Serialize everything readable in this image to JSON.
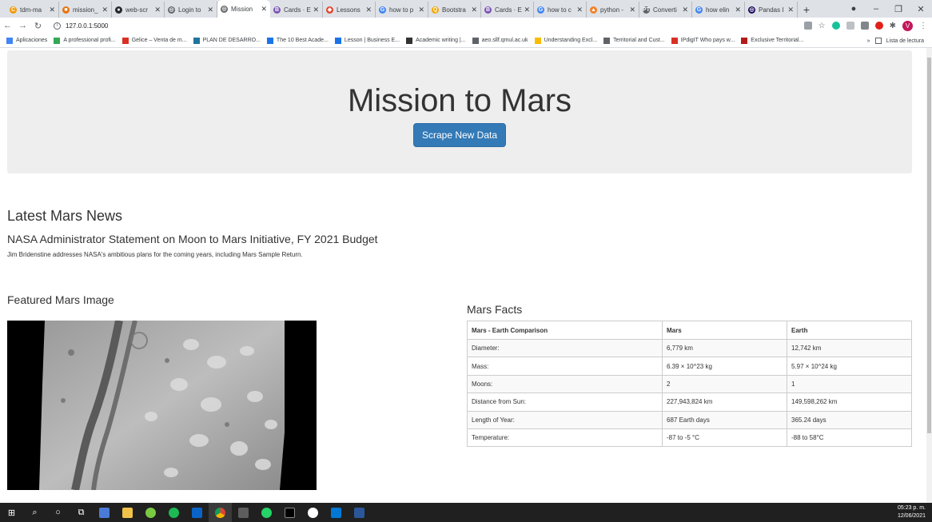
{
  "browser": {
    "tabs": [
      {
        "label": "tdm-ma",
        "color": "#f29900"
      },
      {
        "label": "mission_",
        "color": "#e8710a"
      },
      {
        "label": "web-scr",
        "color": "#24292e"
      },
      {
        "label": "Login to",
        "color": "#5f6368"
      },
      {
        "label": "Mission",
        "color": "#5f6368"
      },
      {
        "label": "Cards · E",
        "color": "#7952b3"
      },
      {
        "label": "Lessons",
        "color": "#e24329"
      },
      {
        "label": "how to p",
        "color": "#4285f4"
      },
      {
        "label": "Bootstra",
        "color": "#f2a600"
      },
      {
        "label": "Cards · E",
        "color": "#7952b3"
      },
      {
        "label": "how to c",
        "color": "#4285f4"
      },
      {
        "label": "python -",
        "color": "#f48024"
      },
      {
        "label": "Converti",
        "color": "#5f6368"
      },
      {
        "label": "how elin",
        "color": "#4285f4"
      },
      {
        "label": "Pandas I",
        "color": "#150458"
      }
    ],
    "tab_glyphs": [
      "C",
      "■",
      "●",
      "◎",
      "◎",
      "B",
      "◆",
      "G",
      "Q",
      "B",
      "G",
      "▲",
      "PT",
      "G",
      "◎"
    ],
    "url": "127.0.0.1:5000",
    "bookmarks": [
      {
        "label": "Aplicaciones",
        "color": "#4285f4"
      },
      {
        "label": "A professional profi...",
        "color": "#34a853"
      },
      {
        "label": "Gelice – Venta de m...",
        "color": "#d93025"
      },
      {
        "label": "PLAN DE DESARRO...",
        "color": "#21759b"
      },
      {
        "label": "The 10 Best Acade...",
        "color": "#1a73e8"
      },
      {
        "label": "Lesson | Business E...",
        "color": "#1a73e8"
      },
      {
        "label": "Academic writing |...",
        "color": "#333333"
      },
      {
        "label": "aeo.sllf.qmul.ac.uk",
        "color": "#5f6368"
      },
      {
        "label": "Understanding Excl...",
        "color": "#fbbc04"
      },
      {
        "label": "Territorial and Cust...",
        "color": "#5f6368"
      },
      {
        "label": "IPdigIT Who pays w...",
        "color": "#d93025"
      },
      {
        "label": "Exclusive Territorial...",
        "color": "#b31b1b"
      }
    ],
    "more_bookmarks": "»",
    "reading_list": "Lista de lectura",
    "profile_initial": "V"
  },
  "page": {
    "title": "Mission to Mars",
    "scrape_button": "Scrape New Data",
    "news_heading": "Latest Mars News",
    "news_title": "NASA Administrator Statement on Moon to Mars Initiative, FY 2021 Budget",
    "news_paragraph": "Jim Bridenstine addresses NASA's ambitious plans for the coming years, including Mars Sample Return.",
    "image_heading": "Featured Mars Image",
    "facts_heading": "Mars Facts",
    "facts_headers": [
      "Mars - Earth Comparison",
      "Mars",
      "Earth"
    ],
    "facts_rows": [
      [
        "Diameter:",
        "6,779 km",
        "12,742 km"
      ],
      [
        "Mass:",
        "6.39 × 10^23 kg",
        "5.97 × 10^24 kg"
      ],
      [
        "Moons:",
        "2",
        "1"
      ],
      [
        "Distance from Sun:",
        "227,943,824 km",
        "149,598,262 km"
      ],
      [
        "Length of Year:",
        "687 Earth days",
        "365.24 days"
      ],
      [
        "Temperature:",
        "-87 to -5 °C",
        "-88 to 58°C"
      ]
    ]
  },
  "taskbar": {
    "time": "05:23 p. m.",
    "date": "12/06/2021"
  }
}
